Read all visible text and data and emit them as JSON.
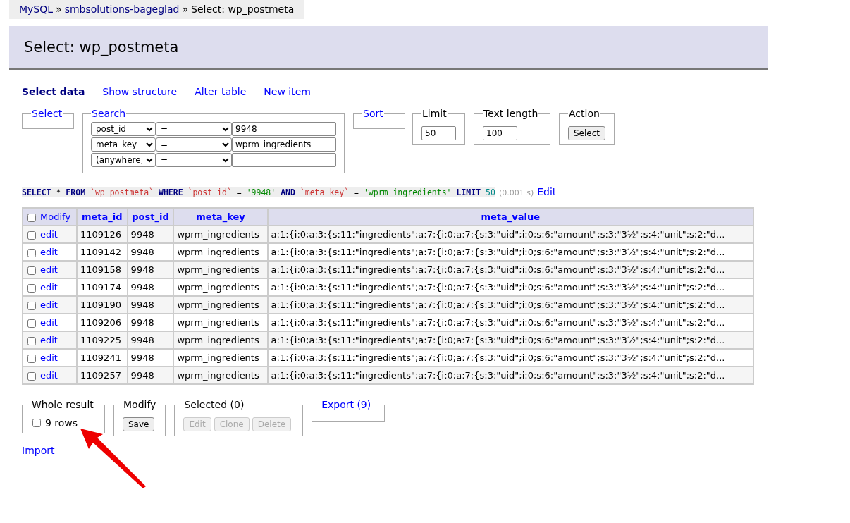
{
  "breadcrumb": [
    {
      "text": "MySQL",
      "kind": "link"
    },
    {
      "text": "»",
      "kind": "sep"
    },
    {
      "text": "smbsolutions-bageglad",
      "kind": "link"
    },
    {
      "text": "»",
      "kind": "sep"
    },
    {
      "text": "Select: wp_postmeta",
      "kind": "text"
    }
  ],
  "page_title": "Select: wp_postmeta",
  "nav_links": [
    {
      "label": "Select data",
      "selected": true
    },
    {
      "label": "Show structure",
      "selected": false
    },
    {
      "label": "Alter table",
      "selected": false
    },
    {
      "label": "New item",
      "selected": false
    }
  ],
  "select_legend": "Select",
  "search": {
    "legend": "Search",
    "rows": [
      {
        "column": "post_id",
        "operator": "=",
        "value": "9948"
      },
      {
        "column": "meta_key",
        "operator": "=",
        "value": "wprm_ingredients"
      },
      {
        "column": "(anywhere)",
        "operator": "="
      }
    ]
  },
  "sort_legend": "Sort",
  "limit": {
    "legend": "Limit",
    "value": "50"
  },
  "text_length": {
    "legend": "Text length",
    "value": "100"
  },
  "action": {
    "legend": "Action",
    "button": "Select"
  },
  "sql": [
    {
      "text": "SELECT",
      "kind": "keyword"
    },
    {
      "text": "*",
      "kind": "plain"
    },
    {
      "text": "FROM",
      "kind": "keyword"
    },
    {
      "text": "`wp_postmeta`",
      "kind": "identifier"
    },
    {
      "text": "WHERE",
      "kind": "keyword"
    },
    {
      "text": "`post_id`",
      "kind": "identifier"
    },
    {
      "text": "=",
      "kind": "plain"
    },
    {
      "text": "'9948'",
      "kind": "string"
    },
    {
      "text": "AND",
      "kind": "keyword"
    },
    {
      "text": "`meta_key`",
      "kind": "identifier"
    },
    {
      "text": "=",
      "kind": "plain"
    },
    {
      "text": "'wprm_ingredients'",
      "kind": "string"
    },
    {
      "text": "LIMIT",
      "kind": "keyword"
    },
    {
      "text": "50",
      "kind": "number"
    }
  ],
  "sql_time": "(0.001 s)",
  "sql_edit": "Edit",
  "table": {
    "all_checked": false,
    "modify_label": "Modify",
    "columns": [
      "meta_id",
      "post_id",
      "meta_key",
      "meta_value"
    ],
    "rows": [
      {
        "checked": false,
        "edit": "edit",
        "cells": [
          "1109126",
          "9948",
          "wprm_ingredients",
          "a:1:{i:0;a:3:{s:11:\"ingredients\";a:7:{i:0;a:7:{s:3:\"uid\";i:0;s:6:\"amount\";s:3:\"3½\";s:4:\"unit\";s:2:\"d..."
        ]
      },
      {
        "checked": false,
        "edit": "edit",
        "cells": [
          "1109142",
          "9948",
          "wprm_ingredients",
          "a:1:{i:0;a:3:{s:11:\"ingredients\";a:7:{i:0;a:7:{s:3:\"uid\";i:0;s:6:\"amount\";s:3:\"3½\";s:4:\"unit\";s:2:\"d..."
        ]
      },
      {
        "checked": false,
        "edit": "edit",
        "cells": [
          "1109158",
          "9948",
          "wprm_ingredients",
          "a:1:{i:0;a:3:{s:11:\"ingredients\";a:7:{i:0;a:7:{s:3:\"uid\";i:0;s:6:\"amount\";s:3:\"3½\";s:4:\"unit\";s:2:\"d..."
        ]
      },
      {
        "checked": false,
        "edit": "edit",
        "cells": [
          "1109174",
          "9948",
          "wprm_ingredients",
          "a:1:{i:0;a:3:{s:11:\"ingredients\";a:7:{i:0;a:7:{s:3:\"uid\";i:0;s:6:\"amount\";s:3:\"3½\";s:4:\"unit\";s:2:\"d..."
        ]
      },
      {
        "checked": false,
        "edit": "edit",
        "cells": [
          "1109190",
          "9948",
          "wprm_ingredients",
          "a:1:{i:0;a:3:{s:11:\"ingredients\";a:7:{i:0;a:7:{s:3:\"uid\";i:0;s:6:\"amount\";s:3:\"3½\";s:4:\"unit\";s:2:\"d..."
        ]
      },
      {
        "checked": false,
        "edit": "edit",
        "cells": [
          "1109206",
          "9948",
          "wprm_ingredients",
          "a:1:{i:0;a:3:{s:11:\"ingredients\";a:7:{i:0;a:7:{s:3:\"uid\";i:0;s:6:\"amount\";s:3:\"3½\";s:4:\"unit\";s:2:\"d..."
        ]
      },
      {
        "checked": false,
        "edit": "edit",
        "cells": [
          "1109225",
          "9948",
          "wprm_ingredients",
          "a:1:{i:0;a:3:{s:11:\"ingredients\";a:7:{i:0;a:7:{s:3:\"uid\";i:0;s:6:\"amount\";s:3:\"3½\";s:4:\"unit\";s:2:\"d..."
        ]
      },
      {
        "checked": false,
        "edit": "edit",
        "cells": [
          "1109241",
          "9948",
          "wprm_ingredients",
          "a:1:{i:0;a:3:{s:11:\"ingredients\";a:7:{i:0;a:7:{s:3:\"uid\";i:0;s:6:\"amount\";s:3:\"3½\";s:4:\"unit\";s:2:\"d..."
        ]
      },
      {
        "checked": false,
        "edit": "edit",
        "cells": [
          "1109257",
          "9948",
          "wprm_ingredients",
          "a:1:{i:0;a:3:{s:11:\"ingredients\";a:7:{i:0;a:7:{s:3:\"uid\";i:0;s:6:\"amount\";s:3:\"3½\";s:4:\"unit\";s:2:\"d..."
        ]
      }
    ]
  },
  "whole_result": {
    "legend": "Whole result",
    "label": "9 rows",
    "checked": false
  },
  "modify": {
    "legend": "Modify",
    "button": "Save"
  },
  "selected": {
    "legend": "Selected (0)",
    "buttons": [
      {
        "label": "Edit",
        "disabled": true
      },
      {
        "label": "Clone",
        "disabled": true
      },
      {
        "label": "Delete",
        "disabled": true
      }
    ]
  },
  "export_legend": "Export (9)",
  "import_link": "Import"
}
